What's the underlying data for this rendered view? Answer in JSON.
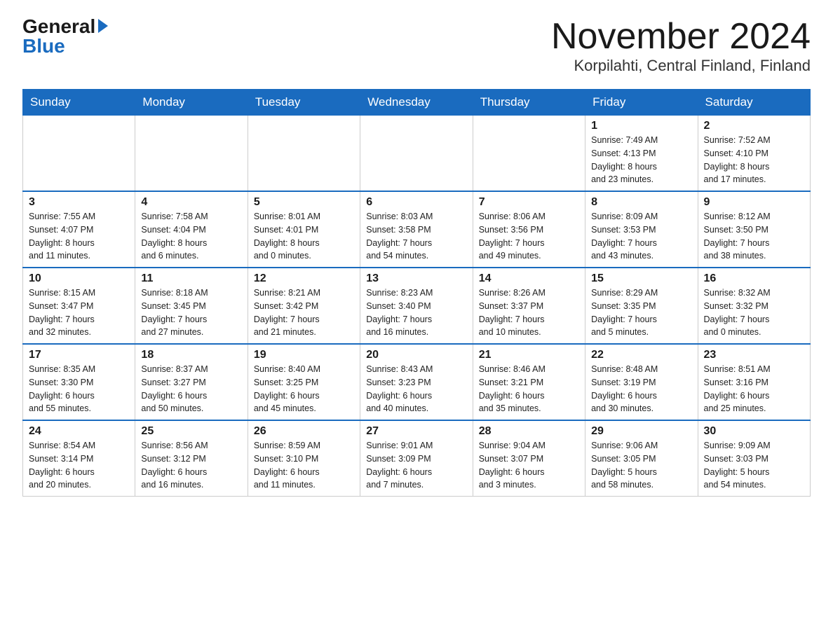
{
  "header": {
    "logo_general": "General",
    "logo_blue": "Blue",
    "month_title": "November 2024",
    "location": "Korpilahti, Central Finland, Finland"
  },
  "weekdays": [
    "Sunday",
    "Monday",
    "Tuesday",
    "Wednesday",
    "Thursday",
    "Friday",
    "Saturday"
  ],
  "weeks": [
    [
      {
        "day": "",
        "info": ""
      },
      {
        "day": "",
        "info": ""
      },
      {
        "day": "",
        "info": ""
      },
      {
        "day": "",
        "info": ""
      },
      {
        "day": "",
        "info": ""
      },
      {
        "day": "1",
        "info": "Sunrise: 7:49 AM\nSunset: 4:13 PM\nDaylight: 8 hours\nand 23 minutes."
      },
      {
        "day": "2",
        "info": "Sunrise: 7:52 AM\nSunset: 4:10 PM\nDaylight: 8 hours\nand 17 minutes."
      }
    ],
    [
      {
        "day": "3",
        "info": "Sunrise: 7:55 AM\nSunset: 4:07 PM\nDaylight: 8 hours\nand 11 minutes."
      },
      {
        "day": "4",
        "info": "Sunrise: 7:58 AM\nSunset: 4:04 PM\nDaylight: 8 hours\nand 6 minutes."
      },
      {
        "day": "5",
        "info": "Sunrise: 8:01 AM\nSunset: 4:01 PM\nDaylight: 8 hours\nand 0 minutes."
      },
      {
        "day": "6",
        "info": "Sunrise: 8:03 AM\nSunset: 3:58 PM\nDaylight: 7 hours\nand 54 minutes."
      },
      {
        "day": "7",
        "info": "Sunrise: 8:06 AM\nSunset: 3:56 PM\nDaylight: 7 hours\nand 49 minutes."
      },
      {
        "day": "8",
        "info": "Sunrise: 8:09 AM\nSunset: 3:53 PM\nDaylight: 7 hours\nand 43 minutes."
      },
      {
        "day": "9",
        "info": "Sunrise: 8:12 AM\nSunset: 3:50 PM\nDaylight: 7 hours\nand 38 minutes."
      }
    ],
    [
      {
        "day": "10",
        "info": "Sunrise: 8:15 AM\nSunset: 3:47 PM\nDaylight: 7 hours\nand 32 minutes."
      },
      {
        "day": "11",
        "info": "Sunrise: 8:18 AM\nSunset: 3:45 PM\nDaylight: 7 hours\nand 27 minutes."
      },
      {
        "day": "12",
        "info": "Sunrise: 8:21 AM\nSunset: 3:42 PM\nDaylight: 7 hours\nand 21 minutes."
      },
      {
        "day": "13",
        "info": "Sunrise: 8:23 AM\nSunset: 3:40 PM\nDaylight: 7 hours\nand 16 minutes."
      },
      {
        "day": "14",
        "info": "Sunrise: 8:26 AM\nSunset: 3:37 PM\nDaylight: 7 hours\nand 10 minutes."
      },
      {
        "day": "15",
        "info": "Sunrise: 8:29 AM\nSunset: 3:35 PM\nDaylight: 7 hours\nand 5 minutes."
      },
      {
        "day": "16",
        "info": "Sunrise: 8:32 AM\nSunset: 3:32 PM\nDaylight: 7 hours\nand 0 minutes."
      }
    ],
    [
      {
        "day": "17",
        "info": "Sunrise: 8:35 AM\nSunset: 3:30 PM\nDaylight: 6 hours\nand 55 minutes."
      },
      {
        "day": "18",
        "info": "Sunrise: 8:37 AM\nSunset: 3:27 PM\nDaylight: 6 hours\nand 50 minutes."
      },
      {
        "day": "19",
        "info": "Sunrise: 8:40 AM\nSunset: 3:25 PM\nDaylight: 6 hours\nand 45 minutes."
      },
      {
        "day": "20",
        "info": "Sunrise: 8:43 AM\nSunset: 3:23 PM\nDaylight: 6 hours\nand 40 minutes."
      },
      {
        "day": "21",
        "info": "Sunrise: 8:46 AM\nSunset: 3:21 PM\nDaylight: 6 hours\nand 35 minutes."
      },
      {
        "day": "22",
        "info": "Sunrise: 8:48 AM\nSunset: 3:19 PM\nDaylight: 6 hours\nand 30 minutes."
      },
      {
        "day": "23",
        "info": "Sunrise: 8:51 AM\nSunset: 3:16 PM\nDaylight: 6 hours\nand 25 minutes."
      }
    ],
    [
      {
        "day": "24",
        "info": "Sunrise: 8:54 AM\nSunset: 3:14 PM\nDaylight: 6 hours\nand 20 minutes."
      },
      {
        "day": "25",
        "info": "Sunrise: 8:56 AM\nSunset: 3:12 PM\nDaylight: 6 hours\nand 16 minutes."
      },
      {
        "day": "26",
        "info": "Sunrise: 8:59 AM\nSunset: 3:10 PM\nDaylight: 6 hours\nand 11 minutes."
      },
      {
        "day": "27",
        "info": "Sunrise: 9:01 AM\nSunset: 3:09 PM\nDaylight: 6 hours\nand 7 minutes."
      },
      {
        "day": "28",
        "info": "Sunrise: 9:04 AM\nSunset: 3:07 PM\nDaylight: 6 hours\nand 3 minutes."
      },
      {
        "day": "29",
        "info": "Sunrise: 9:06 AM\nSunset: 3:05 PM\nDaylight: 5 hours\nand 58 minutes."
      },
      {
        "day": "30",
        "info": "Sunrise: 9:09 AM\nSunset: 3:03 PM\nDaylight: 5 hours\nand 54 minutes."
      }
    ]
  ]
}
